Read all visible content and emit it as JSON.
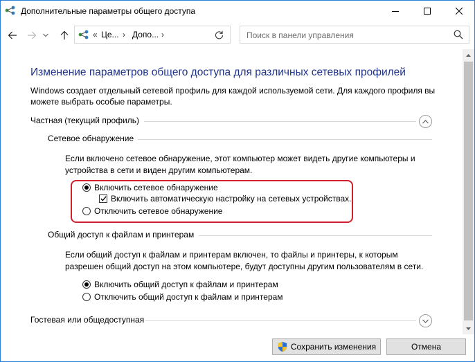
{
  "window": {
    "title": "Дополнительные параметры общего доступа",
    "accent_color": "#1e3287",
    "highlight_color": "#d0202e"
  },
  "navigation": {
    "back_icon": "arrow-left-icon",
    "forward_icon": "arrow-right-icon",
    "recent_icon": "chevron-down-icon",
    "up_icon": "arrow-up-icon",
    "address_separator": "«",
    "breadcrumb_1": "Це...",
    "breadcrumb_sep": "›",
    "breadcrumb_2": "Допо...",
    "breadcrumb_sep_2": "›",
    "refresh_icon": "refresh-icon",
    "search_placeholder": "Поиск в панели управления"
  },
  "main": {
    "heading": "Изменение параметров общего доступа для различных сетевых профилей",
    "intro": "Windows создает отдельный сетевой профиль для каждой используемой сети. Для каждого профиля вы можете выбрать особые параметры.",
    "profile_private": {
      "label": "Частная (текущий профиль)",
      "expanded": true,
      "network_discovery": {
        "label": "Сетевое обнаружение",
        "description": "Если включено сетевое обнаружение, этот компьютер может видеть другие компьютеры и устройства в сети и виден другим компьютерам.",
        "option_on": "Включить сетевое обнаружение",
        "option_auto": "Включить автоматическую настройку на сетевых устройствах.",
        "option_off": "Отключить сетевое обнаружение",
        "selected": "on",
        "auto_checked": true
      },
      "file_sharing": {
        "label": "Общий доступ к файлам и принтерам",
        "description": "Если общий доступ к файлам и принтерам включен, то файлы и принтеры, к которым разрешен общий доступ на этом компьютере, будут доступны другим пользователям в сети.",
        "option_on": "Включить общий доступ к файлам и принтерам",
        "option_off": "Отключить общий доступ к файлам и принтерам",
        "selected": "on"
      }
    },
    "profile_guest": {
      "label": "Гостевая или общедоступная",
      "expanded": false
    }
  },
  "footer": {
    "save_label": "Сохранить изменения",
    "cancel_label": "Отмена"
  }
}
